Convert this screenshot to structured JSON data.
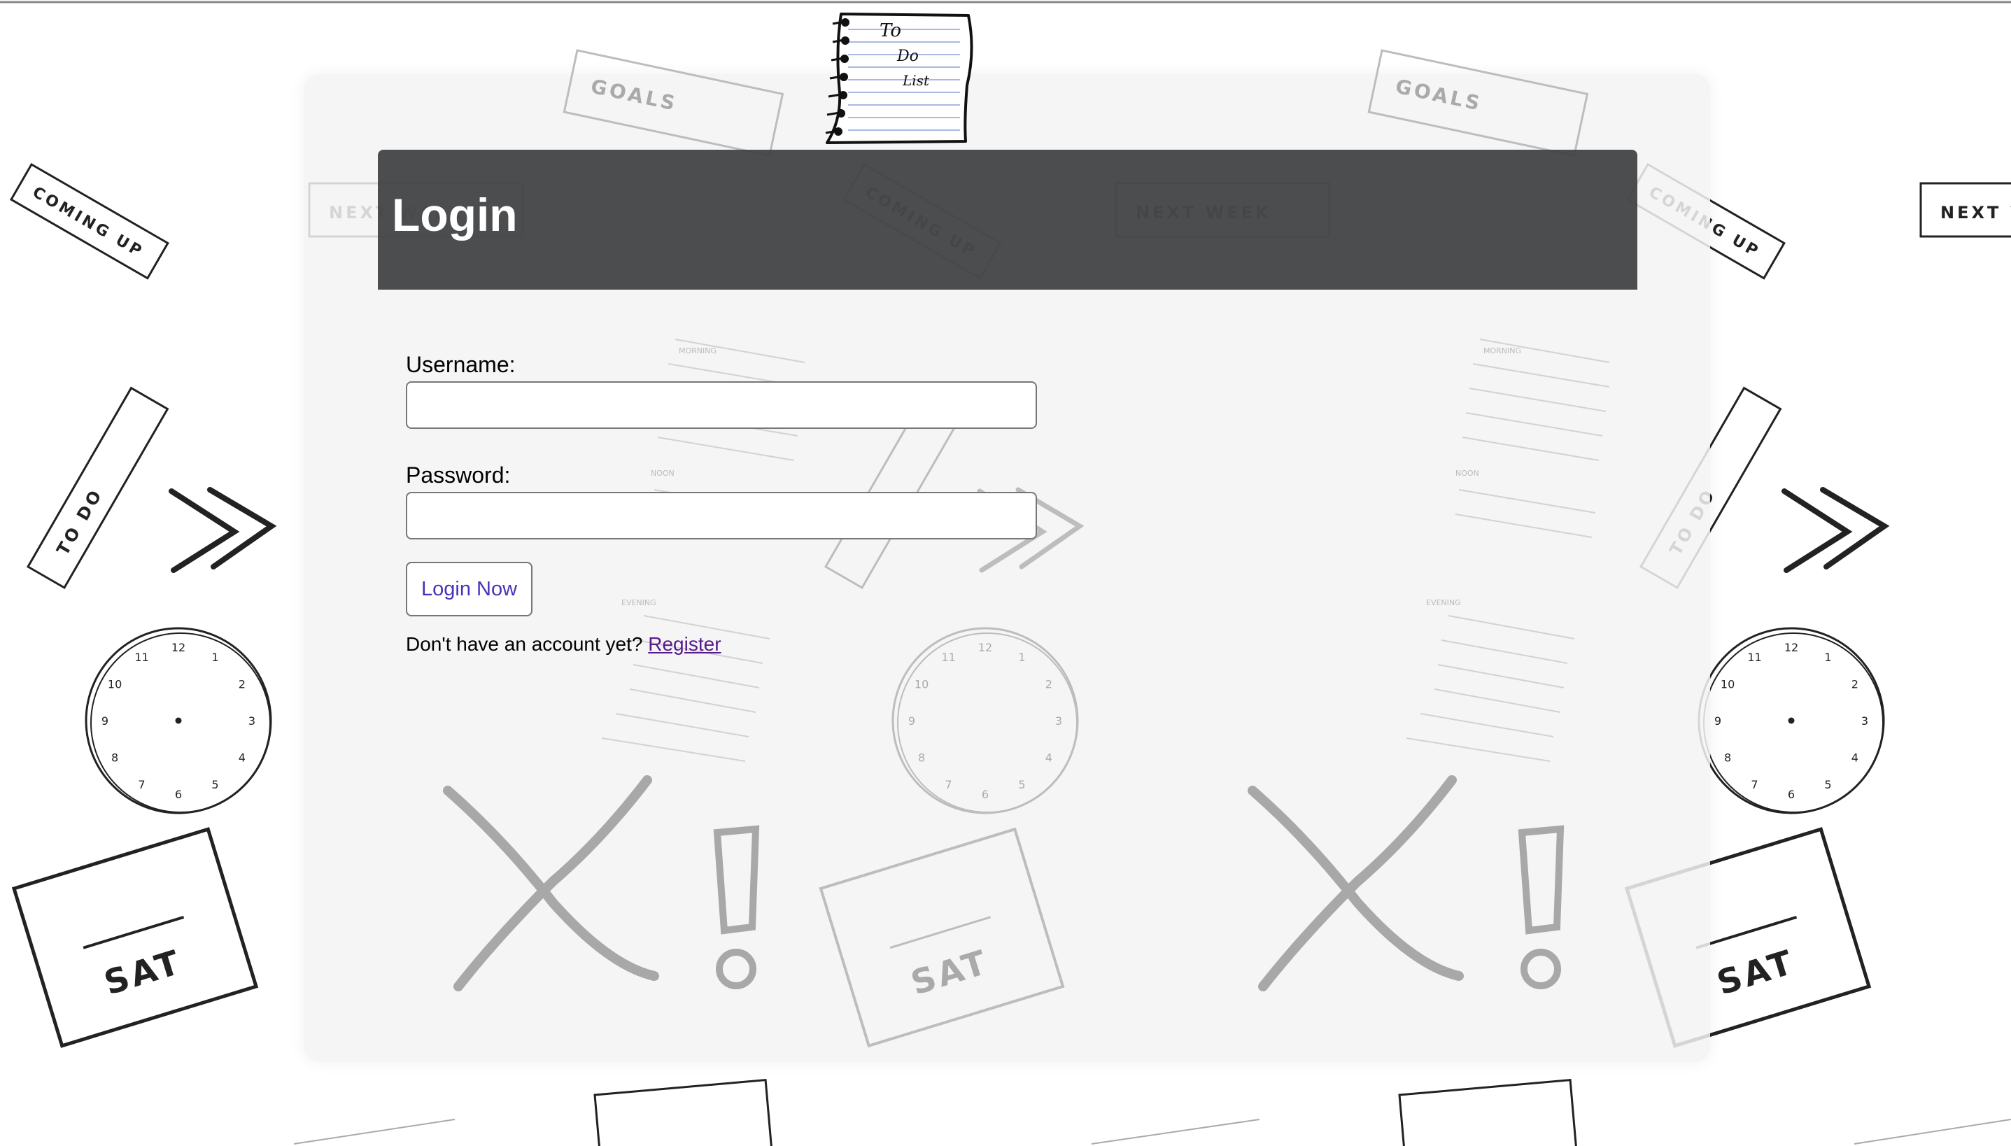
{
  "login": {
    "title": "Login",
    "username_label": "Username:",
    "username_value": "",
    "password_label": "Password:",
    "password_value": "",
    "submit_label": "Login Now",
    "no_account_text": "Don't have an account yet?",
    "register_link": "Register"
  },
  "logo": {
    "line1": "To",
    "line2": "Do",
    "line3": "List"
  },
  "background": {
    "stickers": {
      "coming_up": "COMING UP",
      "next_week": "NEXT WEEK",
      "goals": "GOALS",
      "to_do": "TO DO",
      "sat": "SAT",
      "morning": "MORNING",
      "noon": "NOON",
      "evening": "EVENING"
    },
    "clock_numbers": [
      "12",
      "1",
      "2",
      "3",
      "4",
      "5",
      "6",
      "7",
      "8",
      "9",
      "10",
      "11"
    ]
  },
  "colors": {
    "header_bg": "#3e3f42",
    "button_text": "#4a32b8",
    "link": "#551a8b",
    "panel_bg": "#f3f3f3"
  }
}
